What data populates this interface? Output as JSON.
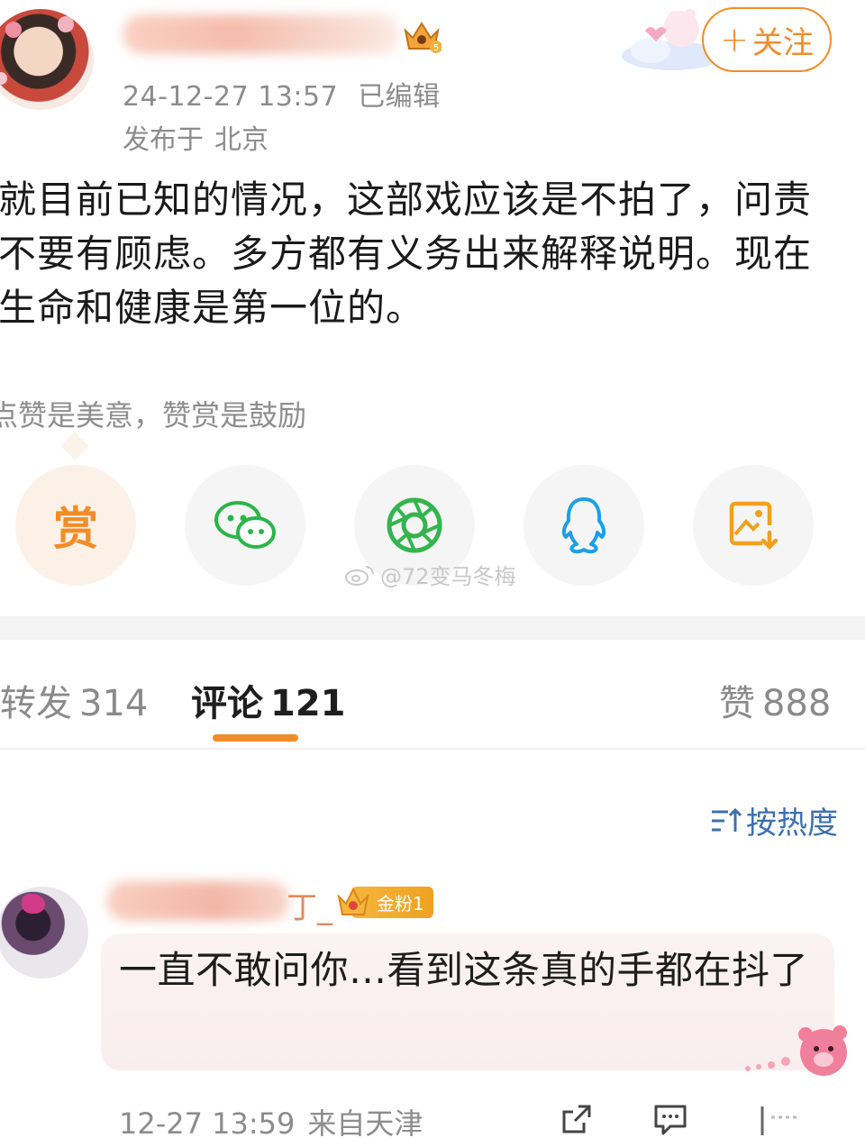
{
  "post": {
    "timestamp": "24-12-27 13:57",
    "edited": "已编辑",
    "location_prefix": "发布于",
    "location": "北京",
    "follow_label": "关注",
    "body_lines": [
      "就目前已知的情况，这部戏应该是不拍了，问责",
      "不要有顾虑。多方都有义务出来解释说明。现在",
      "生命和健康是第一位的。"
    ],
    "reward_tip": "点赞是美意，赞赏是鼓励"
  },
  "share": {
    "items": [
      {
        "name": "reward",
        "label": "赏",
        "icon": "reward-icon"
      },
      {
        "name": "wechat",
        "icon": "wechat-icon"
      },
      {
        "name": "moments",
        "icon": "moments-icon"
      },
      {
        "name": "qq",
        "icon": "qq-icon"
      },
      {
        "name": "save-image",
        "icon": "save-image-icon"
      }
    ]
  },
  "watermark": "@72变马冬梅",
  "tabs": {
    "repost": {
      "label": "转发",
      "count": "314"
    },
    "comments": {
      "label": "评论",
      "count": "121"
    },
    "likes": {
      "label": "赞",
      "count": "888"
    }
  },
  "sort": {
    "label": "按热度"
  },
  "comment": {
    "name_tail": "丁_",
    "badge": "金粉1",
    "text": "一直不敢问你…看到这条真的手都在抖了",
    "timestamp": "12-27 13:59",
    "from": "来自天津"
  },
  "colors": {
    "accent": "#f28c28",
    "link": "#3c6fae",
    "meta": "#8c8c8c"
  }
}
